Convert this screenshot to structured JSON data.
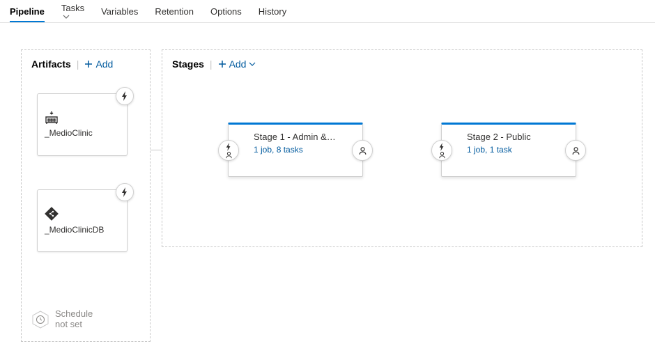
{
  "tabs": {
    "pipeline": "Pipeline",
    "tasks": "Tasks",
    "variables": "Variables",
    "retention": "Retention",
    "options": "Options",
    "history": "History"
  },
  "artifacts": {
    "heading": "Artifacts",
    "add": "Add",
    "items": [
      {
        "name": "_MedioClinic",
        "type": "build"
      },
      {
        "name": "_MedioClinicDB",
        "type": "repo"
      }
    ]
  },
  "stages": {
    "heading": "Stages",
    "add": "Add",
    "items": [
      {
        "title": "Stage 1 - Admin &…",
        "subtitle": "1 job, 8 tasks"
      },
      {
        "title": "Stage 2 - Public",
        "subtitle": "1 job, 1 task"
      }
    ]
  },
  "schedule": {
    "line1": "Schedule",
    "line2": "not set"
  }
}
